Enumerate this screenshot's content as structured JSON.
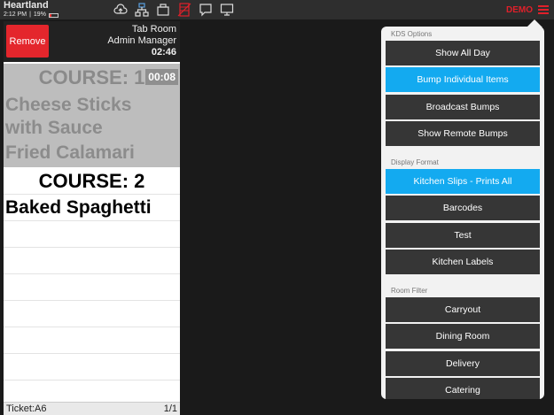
{
  "app": {
    "brand": "Heartland",
    "time": "2:12 PM",
    "battery": "19%",
    "demo_label": "DEMO",
    "colors": {
      "accent_red": "#e0202a",
      "selected_blue": "#13aaf0",
      "button_dark": "#363636"
    },
    "top_icons": [
      "cloud-upload-icon",
      "network-icon",
      "printer-icon",
      "database-icon",
      "chat-icon",
      "monitor-icon"
    ]
  },
  "ticket": {
    "remove_label": "Remove",
    "room": "Tab Room",
    "server": "Admin Manager",
    "timer": "02:46",
    "course1_label": "COURSE: 1",
    "course1_elapsed": "00:08",
    "course1_items": [
      "Cheese Sticks",
      "with Sauce",
      "Fried Calamari"
    ],
    "course2_label": "COURSE: 2",
    "course2_items": [
      "Baked Spaghetti"
    ],
    "footer_ticket": "Ticket:A6",
    "footer_page": "1/1"
  },
  "kds": {
    "sections": [
      {
        "label": "KDS Options",
        "options": [
          {
            "label": "Show All Day",
            "selected": false
          },
          {
            "label": "Bump Individual Items",
            "selected": true
          },
          {
            "label": "Broadcast Bumps",
            "selected": false
          },
          {
            "label": "Show Remote Bumps",
            "selected": false
          }
        ]
      },
      {
        "label": "Display Format",
        "options": [
          {
            "label": "Kitchen Slips - Prints All",
            "selected": true
          },
          {
            "label": "Barcodes",
            "selected": false
          },
          {
            "label": "Test",
            "selected": false
          },
          {
            "label": "Kitchen Labels",
            "selected": false
          }
        ]
      },
      {
        "label": "Room Filter",
        "options": [
          {
            "label": "Carryout",
            "selected": false
          },
          {
            "label": "Dining Room",
            "selected": false
          },
          {
            "label": "Delivery",
            "selected": false
          },
          {
            "label": "Catering",
            "selected": false
          }
        ]
      }
    ]
  }
}
